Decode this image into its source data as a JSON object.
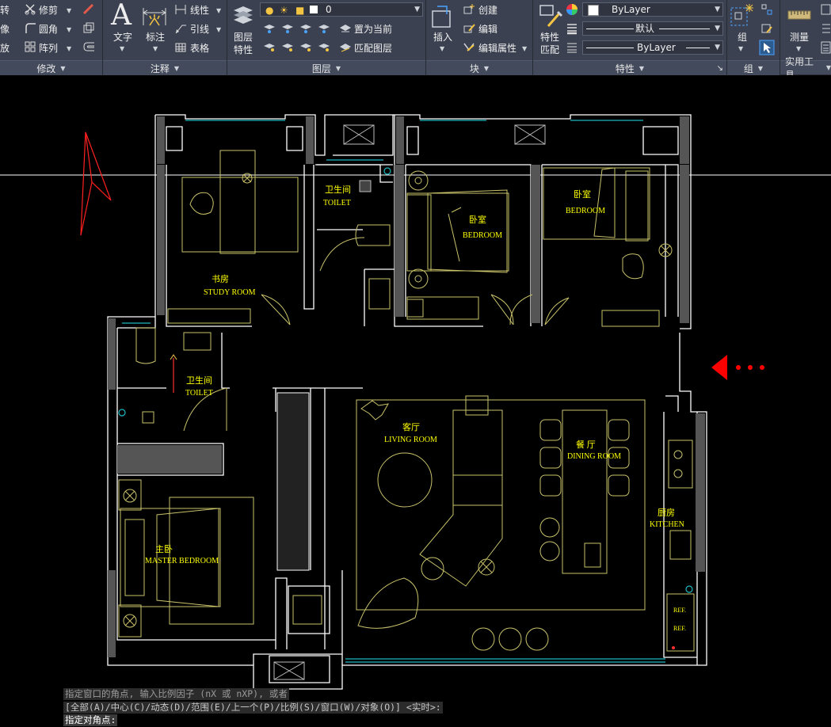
{
  "ribbon": {
    "modify": {
      "rotate": "转",
      "trim": "修剪",
      "mirror": "像",
      "fillet": "圆角",
      "scale": "放",
      "array": "阵列",
      "footer": "修改"
    },
    "annotation": {
      "text": "文字",
      "dimension": "标注",
      "linear": "线性",
      "leader": "引线",
      "table": "表格",
      "footer": "注释"
    },
    "layers": {
      "layer_props_line1": "图层",
      "layer_props_line2": "特性",
      "current_layer": "0",
      "set_current": "置为当前",
      "match_layer": "匹配图层",
      "footer": "图层"
    },
    "block": {
      "insert": "插入",
      "create": "创建",
      "edit": "编辑",
      "edit_attrs": "编辑属性",
      "footer": "块"
    },
    "properties": {
      "match_line1": "特性",
      "match_line2": "匹配",
      "color": "ByLayer",
      "lineweight": "默认",
      "linetype": "ByLayer",
      "footer": "特性"
    },
    "groups": {
      "group": "组",
      "footer": "组"
    },
    "utilities": {
      "measure": "测量",
      "footer": "实用工具"
    }
  },
  "rooms": {
    "toilet_top_cn": "卫生间",
    "toilet_top_en": "TOILET",
    "bedroom1_cn": "卧室",
    "bedroom1_en": "BEDROOM",
    "bedroom2_cn": "卧室",
    "bedroom2_en": "BEDROOM",
    "study_cn": "书房",
    "study_en": "STUDY ROOM",
    "toilet_left_cn": "卫生间",
    "toilet_left_en": "TOILET",
    "living_cn": "客厅",
    "living_en": "LIVING ROOM",
    "dining_cn": "餐 厅",
    "dining_en": "DINING ROOM",
    "kitchen_cn": "厨房",
    "kitchen_en": "KITCHEN",
    "master_cn": "主卧",
    "master_en": "MASTER BEDROOM",
    "ref1": "REF.",
    "ref2": "REF."
  },
  "command": {
    "line1": "指定窗口的角点, 输入比例因子 (nX 或 nXP), 或者",
    "line2": "[全部(A)/中心(C)/动态(D)/范围(E)/上一个(P)/比例(S)/窗口(W)/对象(O)] <实时>:",
    "line3": "指定对角点:"
  },
  "colors": {
    "wall": "#ffffff",
    "furniture": "#c9c26a",
    "window": "#19b8c4",
    "label": "#ffff00",
    "arrow": "#ff0000"
  }
}
